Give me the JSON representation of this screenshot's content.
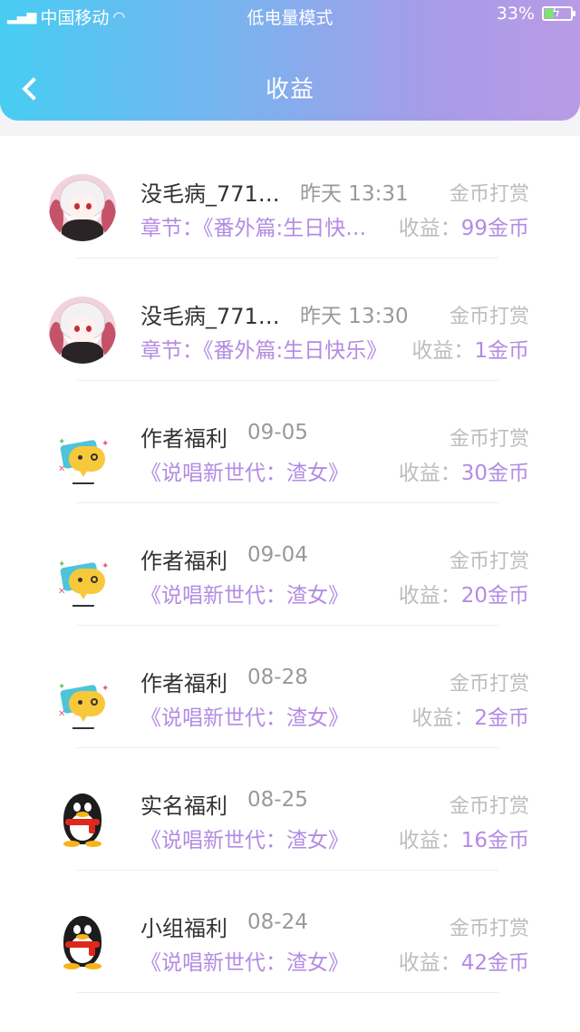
{
  "statusbar": {
    "carrier": "中国移动",
    "mode": "低电量模式",
    "battery": "33%",
    "battery_level": 0.33
  },
  "nav": {
    "title": "收益"
  },
  "rows": [
    {
      "avatar": "anime-avatar",
      "name": "没毛病_771…",
      "time": "昨天 13:31",
      "type": "金币打赏",
      "subtitle": "章节：《番外篇:生日快…",
      "income_label": "收益：",
      "income_amount": "99金币"
    },
    {
      "avatar": "anime-avatar",
      "name": "没毛病_771…",
      "time": "昨天 13:30",
      "type": "金币打赏",
      "subtitle": "章节：《番外篇:生日快乐》",
      "income_label": "收益：",
      "income_amount": "1金币"
    },
    {
      "avatar": "chat-bubble-avatar",
      "name": "作者福利",
      "time": "09-05",
      "type": "金币打赏",
      "subtitle": "《说唱新世代：渣女》",
      "income_label": "收益：",
      "income_amount": "30金币"
    },
    {
      "avatar": "chat-bubble-avatar",
      "name": "作者福利",
      "time": "09-04",
      "type": "金币打赏",
      "subtitle": "《说唱新世代：渣女》",
      "income_label": "收益：",
      "income_amount": "20金币"
    },
    {
      "avatar": "chat-bubble-avatar",
      "name": "作者福利",
      "time": "08-28",
      "type": "金币打赏",
      "subtitle": "《说唱新世代：渣女》",
      "income_label": "收益：",
      "income_amount": "2金币"
    },
    {
      "avatar": "penguin-avatar",
      "name": "实名福利",
      "time": "08-25",
      "type": "金币打赏",
      "subtitle": "《说唱新世代：渣女》",
      "income_label": "收益：",
      "income_amount": "16金币"
    },
    {
      "avatar": "penguin-avatar",
      "name": "小组福利",
      "time": "08-24",
      "type": "金币打赏",
      "subtitle": "《说唱新世代：渣女》",
      "income_label": "收益：",
      "income_amount": "42金币"
    }
  ],
  "colors": {
    "accent": "#b38be3",
    "header_start": "#47cdf2",
    "header_end": "#b99be6"
  }
}
